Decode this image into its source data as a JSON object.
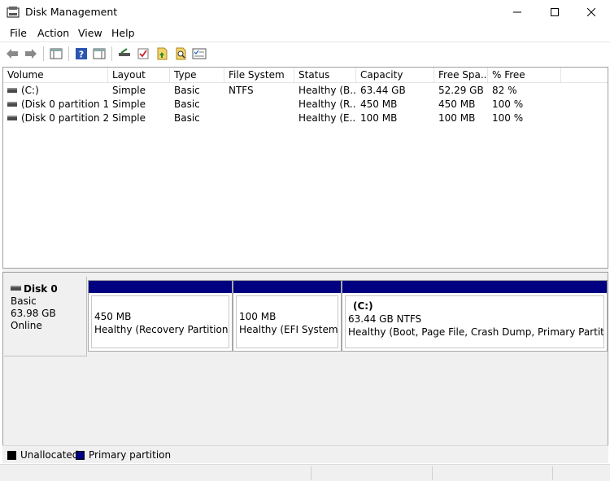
{
  "window": {
    "title": "Disk Management"
  },
  "menu": [
    "File",
    "Action",
    "View",
    "Help"
  ],
  "toolbar": [
    "back-icon",
    "forward-icon",
    "console-tree-icon",
    "help-icon",
    "show-hide-icon",
    "rescan-icon",
    "check-icon",
    "refresh-icon",
    "search-icon",
    "properties-icon"
  ],
  "volume_table": {
    "columns": [
      "Volume",
      "Layout",
      "Type",
      "File System",
      "Status",
      "Capacity",
      "Free Spa...",
      "% Free"
    ],
    "rows": [
      {
        "volume": "(C:)",
        "layout": "Simple",
        "type": "Basic",
        "fs": "NTFS",
        "status": "Healthy (B...",
        "capacity": "63.44 GB",
        "free": "52.29 GB",
        "pct": "82 %"
      },
      {
        "volume": "(Disk 0 partition 1)",
        "layout": "Simple",
        "type": "Basic",
        "fs": "",
        "status": "Healthy (R...",
        "capacity": "450 MB",
        "free": "450 MB",
        "pct": "100 %"
      },
      {
        "volume": "(Disk 0 partition 2)",
        "layout": "Simple",
        "type": "Basic",
        "fs": "",
        "status": "Healthy (E...",
        "capacity": "100 MB",
        "free": "100 MB",
        "pct": "100 %"
      }
    ]
  },
  "disk": {
    "name": "Disk 0",
    "kind": "Basic",
    "size": "63.98 GB",
    "state": "Online",
    "partitions": [
      {
        "label": "",
        "size": "450 MB",
        "status": "Healthy (Recovery Partition)"
      },
      {
        "label": "",
        "size": "100 MB",
        "status": "Healthy (EFI System Pa"
      },
      {
        "label": "(C:)",
        "size": "63.44 GB NTFS",
        "status": "Healthy (Boot, Page File, Crash Dump, Primary Partition)"
      }
    ]
  },
  "legend": [
    {
      "label": "Unallocated",
      "color": "#000000"
    },
    {
      "label": "Primary partition",
      "color": "#000080"
    }
  ],
  "colors": {
    "partition_bar": "#000080"
  }
}
